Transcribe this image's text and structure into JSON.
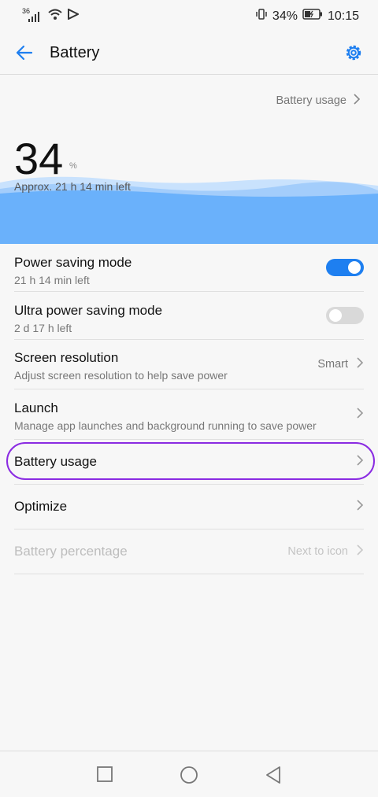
{
  "status": {
    "network": "36",
    "battery_pct": "34%",
    "time": "10:15"
  },
  "header": {
    "title": "Battery"
  },
  "top_link": {
    "label": "Battery usage"
  },
  "battery": {
    "percent": "34",
    "sign": "%",
    "approx": "Approx. 21 h 14 min left"
  },
  "rows": [
    {
      "title": "Power saving mode",
      "subtitle": "21 h 14 min left",
      "toggle": true
    },
    {
      "title": "Ultra power saving mode",
      "subtitle": "2 d 17 h left",
      "toggle": false
    },
    {
      "title": "Screen resolution",
      "subtitle": "Adjust screen resolution to help save power",
      "value": "Smart"
    },
    {
      "title": "Launch",
      "subtitle": "Manage app launches and background running to save power"
    },
    {
      "title": "Battery usage"
    },
    {
      "title": "Optimize"
    },
    {
      "title": "Battery percentage",
      "value": "Next to icon",
      "disabled": true
    }
  ],
  "colors": {
    "accent": "#1e7ff0",
    "toggle_off": "#d9d9d9",
    "wave": "#6ab1fb",
    "highlight": "#8a2be2"
  }
}
